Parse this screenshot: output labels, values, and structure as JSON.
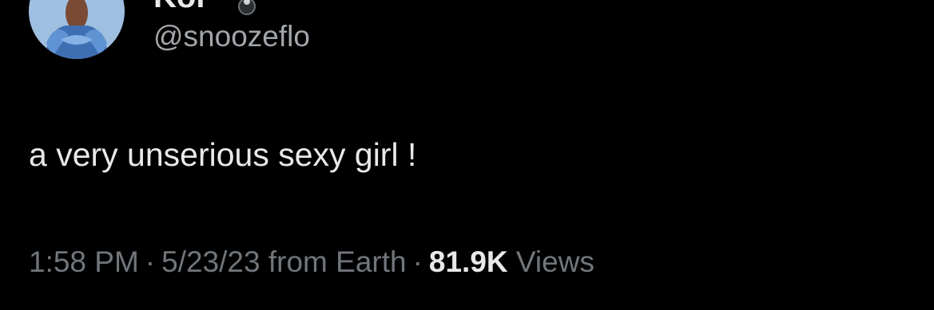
{
  "author": {
    "display_name": "Kor",
    "handle": "@snoozeflo",
    "avatar_icon": "profile-photo",
    "badge_icon": "emoji-badge-icon"
  },
  "tweet": {
    "text": "a very unserious sexy girl !"
  },
  "meta": {
    "time": "1:58 PM",
    "separator_1": "·",
    "date": "5/23/23",
    "source": "from Earth",
    "separator_2": "·",
    "views_count": "81.9K",
    "views_label": "Views"
  },
  "colors": {
    "background": "#000000",
    "primary_text": "#e7e9ea",
    "secondary_text": "#71767b"
  }
}
